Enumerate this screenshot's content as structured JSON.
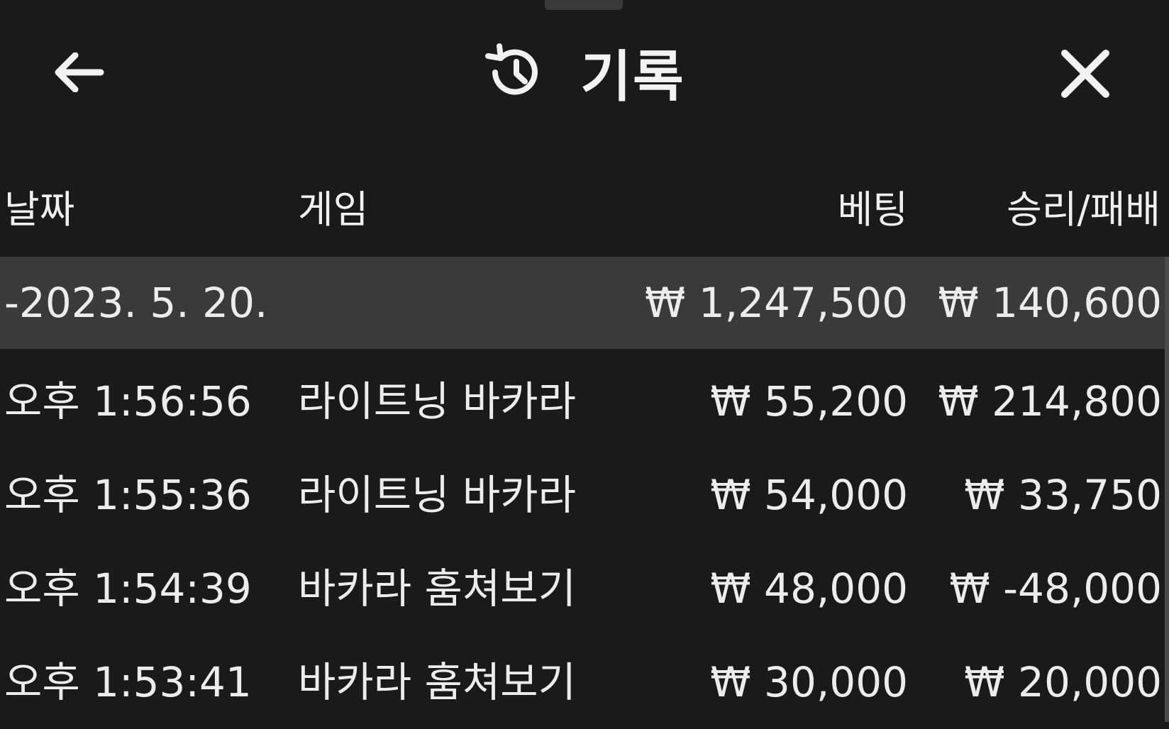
{
  "header": {
    "title": "기록",
    "back_icon": "arrow-left-icon",
    "history_icon": "history-icon",
    "close_icon": "close-icon"
  },
  "columns": {
    "date": "날짜",
    "game": "게임",
    "bet": "베팅",
    "result": "승리/패배"
  },
  "summary": {
    "date": "-2023. 5. 20.",
    "bet": "₩ 1,247,500",
    "result": "₩ 140,600"
  },
  "rows": [
    {
      "time": "오후 1:56:56",
      "game": "라이트닝 바카라",
      "bet": "₩ 55,200",
      "result": "₩ 214,800"
    },
    {
      "time": "오후 1:55:36",
      "game": "라이트닝 바카라",
      "bet": "₩ 54,000",
      "result": "₩ 33,750"
    },
    {
      "time": "오후 1:54:39",
      "game": "바카라 훔쳐보기",
      "bet": "₩ 48,000",
      "result": "₩ -48,000"
    },
    {
      "time": "오후 1:53:41",
      "game": "바카라 훔쳐보기",
      "bet": "₩ 30,000",
      "result": "₩ 20,000"
    }
  ],
  "colors": {
    "background": "#1a1a1b",
    "summary_row": "#3a3a3c",
    "text": "#ececec"
  }
}
